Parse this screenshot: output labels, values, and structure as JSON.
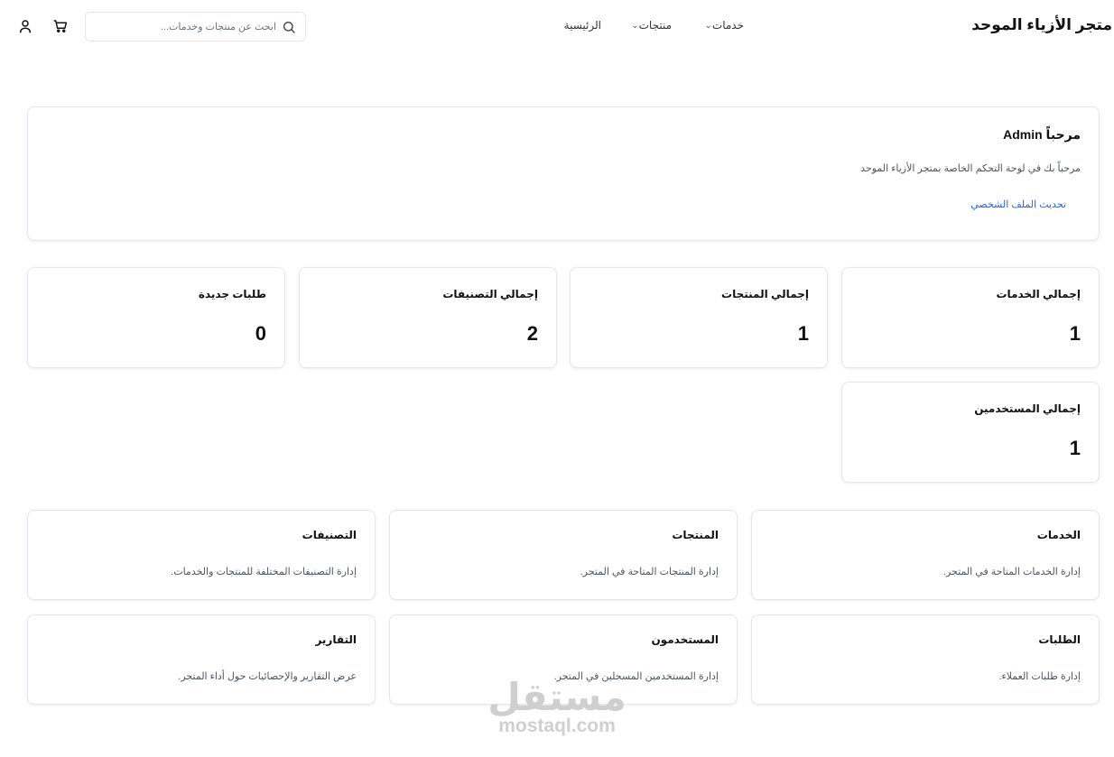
{
  "header": {
    "brand": "متجر الأزياء الموحد",
    "nav": {
      "services": "خدمات",
      "products": "منتجات",
      "home": "الرئيسية"
    },
    "search_placeholder": "ابحث عن منتجات وخدمات..."
  },
  "welcome": {
    "title": "مرحباً Admin",
    "text": "مرحباً بك في لوحة التحكم الخاصة بمتجر الأزياء الموحد",
    "link": "تحديث الملف الشخصي"
  },
  "stats": [
    {
      "label": "إجمالي الخدمات",
      "value": "1"
    },
    {
      "label": "إجمالي المنتجات",
      "value": "1"
    },
    {
      "label": "إجمالي التصنيفات",
      "value": "2"
    },
    {
      "label": "طلبات جديدة",
      "value": "0"
    },
    {
      "label": "إجمالي المستخدمين",
      "value": "1"
    }
  ],
  "management": [
    {
      "title": "الخدمات",
      "desc": "إدارة الخدمات المتاحة في المتجر."
    },
    {
      "title": "المنتجات",
      "desc": "إدارة المنتجات المتاحة في المتجر."
    },
    {
      "title": "التصنيفات",
      "desc": "إدارة التصنيفات المختلفة للمنتجات والخدمات."
    },
    {
      "title": "الطلبات",
      "desc": "إدارة طلبات العملاء."
    },
    {
      "title": "المستخدمون",
      "desc": "إدارة المستخدمين المسجلين في المتجر."
    },
    {
      "title": "التقارير",
      "desc": "عرض التقارير والإحصائيات حول أداء المتجر."
    }
  ],
  "watermark": {
    "arabic": "مستقل",
    "latin": "mostaql.com"
  },
  "colors": {
    "link": "#2563eb",
    "border": "#e5e7eb",
    "watermark": "#cfcfcf"
  }
}
